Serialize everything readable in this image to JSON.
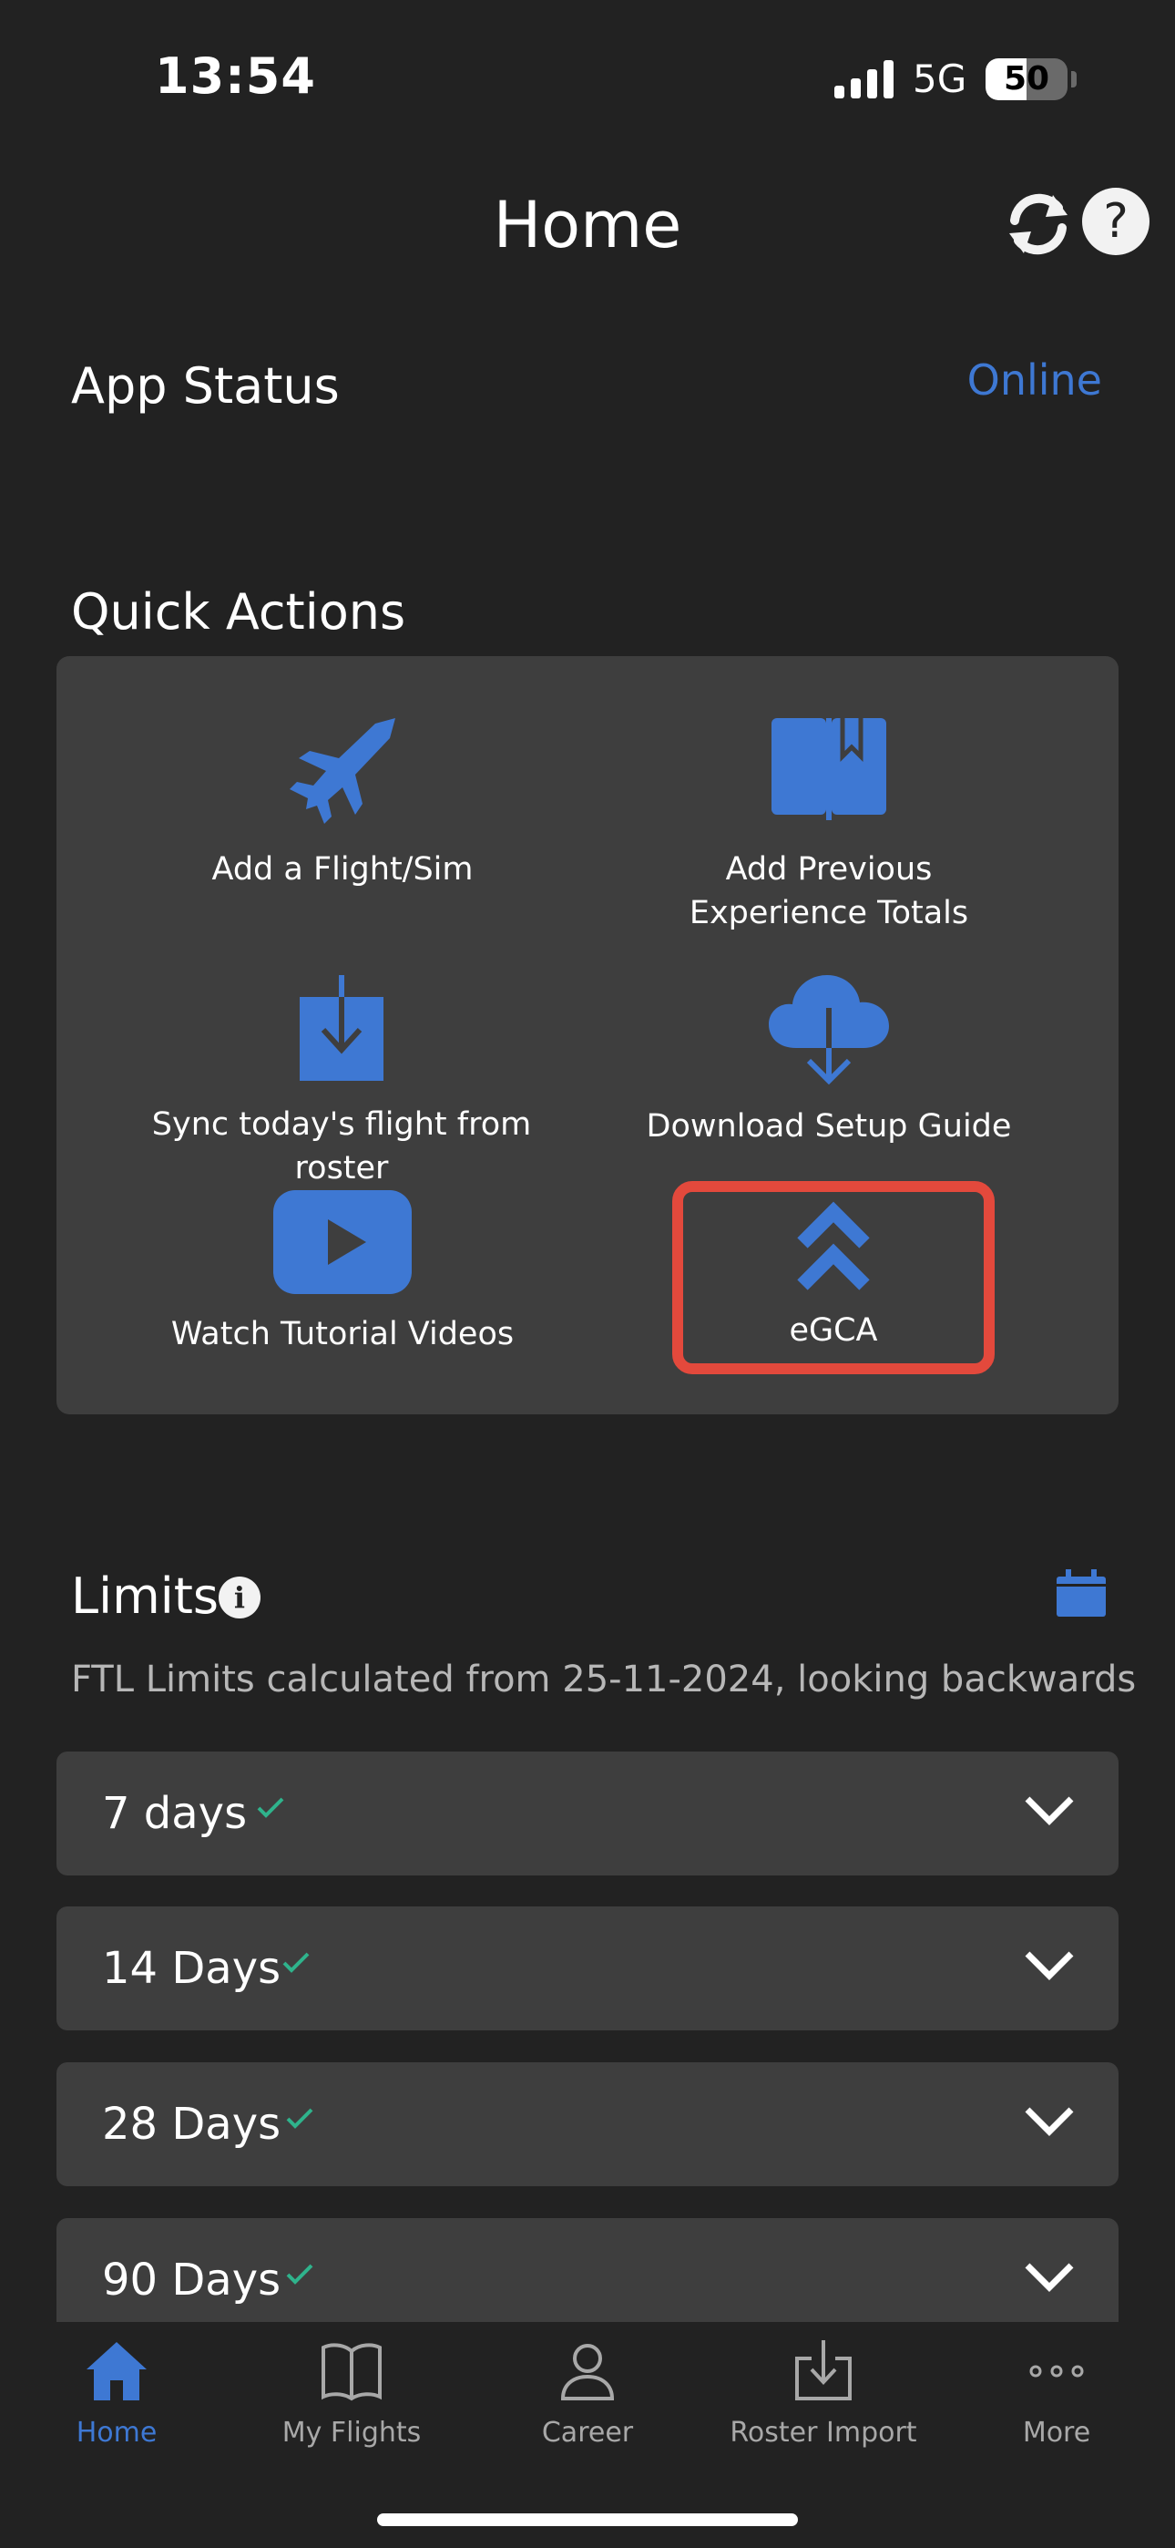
{
  "status_bar": {
    "time": "13:54",
    "network": "5G",
    "battery": "50",
    "battery_level": 0.5
  },
  "header": {
    "title": "Home",
    "refresh_icon": "refresh-icon",
    "help_icon": "help-icon",
    "help_glyph": "?"
  },
  "app_status": {
    "label": "App Status",
    "value": "Online"
  },
  "quick_actions": {
    "title": "Quick Actions",
    "items": [
      {
        "label": "Add a Flight/Sim",
        "icon": "jet-icon"
      },
      {
        "label": "Add Previous Experience Totals",
        "icon": "book-icon"
      },
      {
        "label": "Sync today's flight from roster",
        "icon": "download-box-icon"
      },
      {
        "label": "Download Setup Guide",
        "icon": "cloud-download-icon"
      },
      {
        "label": "Watch Tutorial Videos",
        "icon": "play-icon"
      },
      {
        "label": "eGCA",
        "icon": "double-chevron-up-icon"
      }
    ]
  },
  "limits": {
    "title": "Limits",
    "info_glyph": "i",
    "subtitle": "FTL Limits calculated from 25-11-2024, looking backwards",
    "rows": [
      {
        "label": "7 days"
      },
      {
        "label": "14 Days"
      },
      {
        "label": "28 Days"
      },
      {
        "label": "90 Days"
      }
    ]
  },
  "tabs": [
    {
      "label": "Home",
      "icon": "home-icon",
      "active": true
    },
    {
      "label": "My Flights",
      "icon": "open-book-icon",
      "active": false
    },
    {
      "label": "Career",
      "icon": "person-icon",
      "active": false
    },
    {
      "label": "Roster Import",
      "icon": "import-icon",
      "active": false
    },
    {
      "label": "More",
      "icon": "more-dots-icon",
      "active": false
    }
  ],
  "colors": {
    "background": "#222222",
    "card": "#3e3e3e",
    "accent": "#3e78d3",
    "check": "#2fb38c",
    "highlight": "#e3493c"
  }
}
